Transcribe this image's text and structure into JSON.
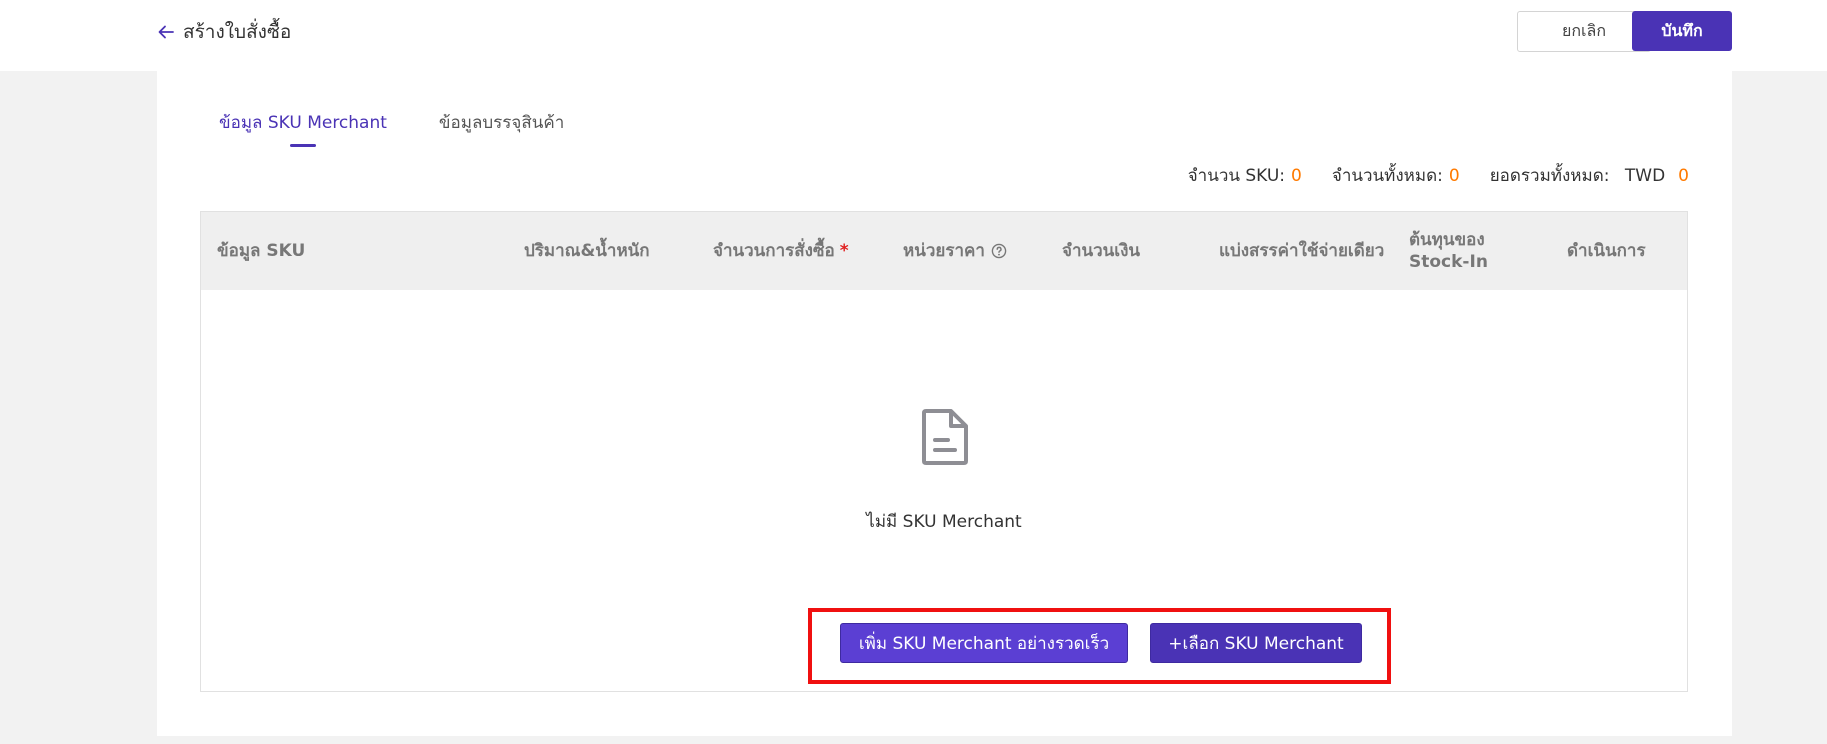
{
  "header": {
    "back_icon": "arrow-left-icon",
    "title": "สร้างใบสั่งซื้อ",
    "cancel_label": "ยกเลิก",
    "save_label": "บันทึก"
  },
  "tabs": [
    {
      "label": "ข้อมูล SKU Merchant",
      "active": true
    },
    {
      "label": "ข้อมูลบรรจุสินค้า",
      "active": false
    }
  ],
  "summary": {
    "sku_count_label": "จำนวน SKU:",
    "sku_count_value": "0",
    "total_qty_label": "จำนวนทั้งหมด:",
    "total_qty_value": "0",
    "total_amount_label": "ยอดรวมทั้งหมด:",
    "currency": "TWD",
    "total_amount_value": "0"
  },
  "table": {
    "columns": [
      {
        "label": "ข้อมูล SKU"
      },
      {
        "label": "ปริมาณ&น้ำหนัก"
      },
      {
        "label": "จำนวนการสั่งซื้อ",
        "required_mark": "*"
      },
      {
        "label": "หน่วยราคา",
        "icon": "help-circle-icon"
      },
      {
        "label": "จำนวนเงิน"
      },
      {
        "label": "แบ่งสรรค่าใช้จ่ายเดียว"
      },
      {
        "label": "ต้นทุนของ Stock-In"
      },
      {
        "label": "ดำเนินการ"
      }
    ],
    "rows": []
  },
  "empty_state": {
    "icon": "document-icon",
    "message": "ไม่มี SKU Merchant",
    "quick_add_label": "เพิ่ม SKU Merchant อย่างรวดเร็ว",
    "select_label": "+เลือก SKU Merchant"
  },
  "colors": {
    "primary": "#4a33b5",
    "accent_number": "#ff7a00",
    "highlight_border": "#f01010"
  }
}
